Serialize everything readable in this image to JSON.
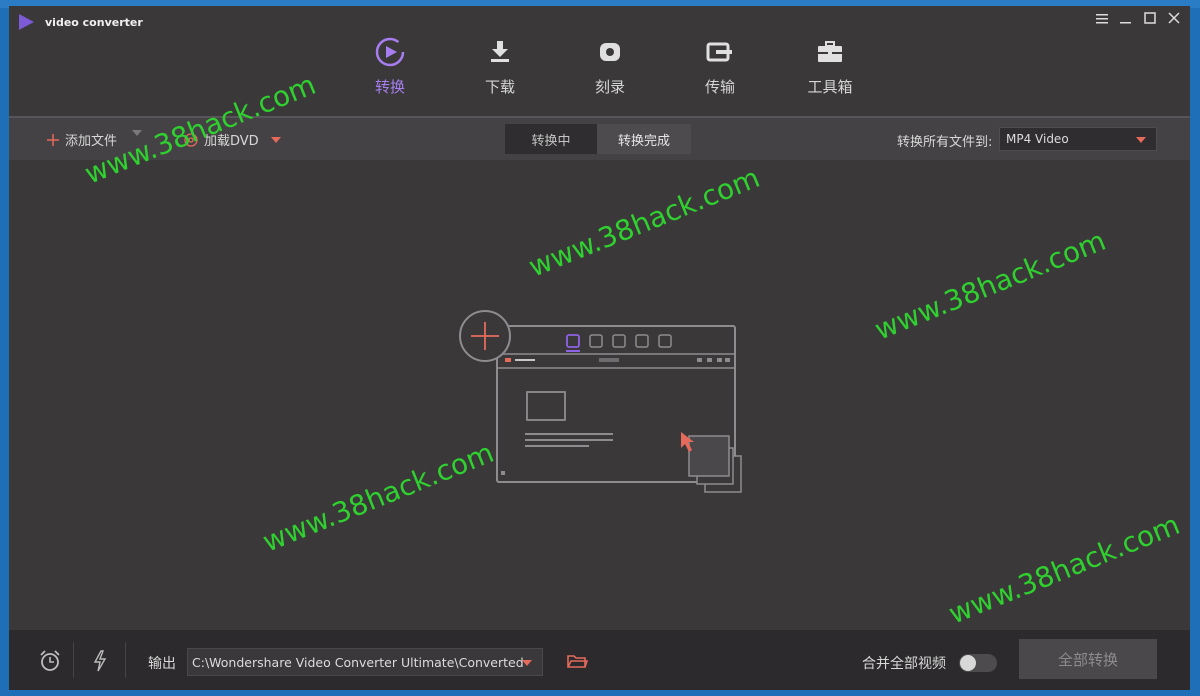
{
  "app": {
    "title": "video converter"
  },
  "window_controls": {
    "menu": "menu-icon",
    "minimize": "minimize-icon",
    "maximize": "maximize-icon",
    "close": "close-icon"
  },
  "tabs": [
    {
      "label": "转换",
      "icon": "convert-play-icon",
      "active": true
    },
    {
      "label": "下载",
      "icon": "download-icon",
      "active": false
    },
    {
      "label": "刻录",
      "icon": "burn-disc-icon",
      "active": false
    },
    {
      "label": "传输",
      "icon": "transfer-icon",
      "active": false
    },
    {
      "label": "工具箱",
      "icon": "toolbox-icon",
      "active": false
    }
  ],
  "toolbar": {
    "add_files": "添加文件",
    "load_dvd": "加载DVD",
    "segment": {
      "converting": "转换中",
      "finished": "转换完成"
    },
    "convert_all_to_label": "转换所有文件到:",
    "format_value": "MP4 Video"
  },
  "footer": {
    "output_label": "输出",
    "output_path": "C:\\Wondershare Video Converter Ultimate\\Converted",
    "merge_label": "合并全部视频",
    "merge_enabled": false,
    "convert_all_button": "全部转换"
  },
  "watermark": {
    "text": "www.38hack.com"
  },
  "colors": {
    "accent_purple": "#8f63e6",
    "accent_red": "#e56a5b",
    "watermark_green": "#2fd02f"
  }
}
